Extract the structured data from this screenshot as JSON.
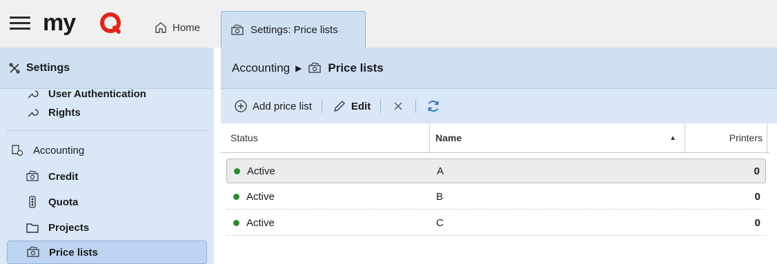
{
  "header": {
    "logo_text": "myQ",
    "home_label": "Home",
    "active_tab_label": "Settings: Price lists"
  },
  "sidebar": {
    "title": "Settings",
    "items": [
      {
        "label": "User Authentication",
        "icon": "rights-icon"
      },
      {
        "label": "Rights",
        "icon": "rights-icon"
      },
      {
        "label": "Accounting",
        "icon": "accounting-icon"
      },
      {
        "label": "Credit",
        "icon": "money-icon"
      },
      {
        "label": "Quota",
        "icon": "quota-icon"
      },
      {
        "label": "Projects",
        "icon": "folder-icon"
      },
      {
        "label": "Price lists",
        "icon": "money-icon",
        "selected": true
      }
    ]
  },
  "breadcrumb": {
    "parent": "Accounting",
    "current": "Price lists"
  },
  "toolbar": {
    "add_label": "Add price list",
    "edit_label": "Edit"
  },
  "table": {
    "columns": [
      "Status",
      "Name",
      "Printers"
    ],
    "sort": {
      "column": "Name",
      "direction": "ascending"
    },
    "rows": [
      {
        "status": "Active",
        "name": "A",
        "printers": "0"
      },
      {
        "status": "Active",
        "name": "B",
        "printers": "0"
      },
      {
        "status": "Active",
        "name": "C",
        "printers": "0"
      }
    ]
  },
  "colors": {
    "accent": "#cfe0f3",
    "sidebar_bg": "#d9e7f6",
    "status_active": "#2e8b2e",
    "logo_red": "#e1251b"
  }
}
